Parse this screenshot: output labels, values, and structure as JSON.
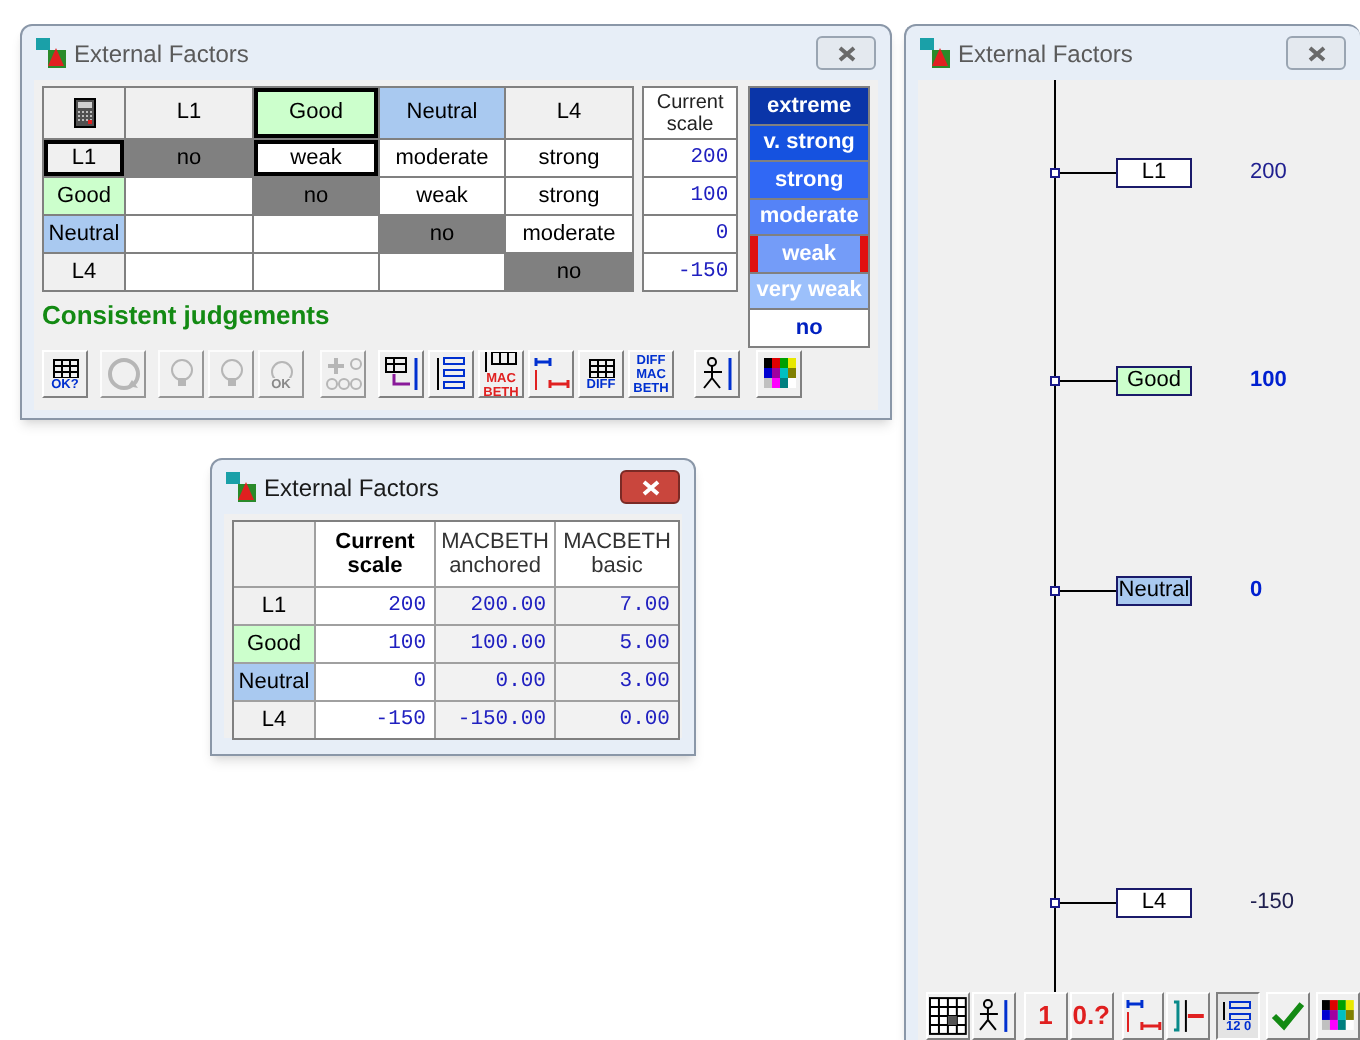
{
  "judgement_window": {
    "title": "External Factors",
    "active": false,
    "columns": [
      {
        "label": "L1",
        "color": "#f0f0f0",
        "selected": false
      },
      {
        "label": "Good",
        "color": "#ccffcc",
        "selected": true
      },
      {
        "label": "Neutral",
        "color": "#a9c9f0",
        "selected": false
      },
      {
        "label": "L4",
        "color": "#f0f0f0",
        "selected": false
      }
    ],
    "scale_header": "Current scale",
    "rows": [
      {
        "label": "L1",
        "color": "#f0f0f0",
        "selected": true,
        "scale": "200",
        "cells": [
          {
            "kind": "diagonal",
            "text": "no",
            "selected": false
          },
          {
            "kind": "judgement",
            "text": "weak",
            "selected": true
          },
          {
            "kind": "judgement",
            "text": "moderate",
            "selected": false
          },
          {
            "kind": "judgement",
            "text": "strong",
            "selected": false
          }
        ]
      },
      {
        "label": "Good",
        "color": "#ccffcc",
        "selected": false,
        "scale": "100",
        "cells": [
          {
            "kind": "empty",
            "selected": false
          },
          {
            "kind": "diagonal",
            "text": "no",
            "selected": false
          },
          {
            "kind": "judgement",
            "text": "weak",
            "selected": false
          },
          {
            "kind": "judgement",
            "text": "strong",
            "selected": false
          }
        ]
      },
      {
        "label": "Neutral",
        "color": "#a9c9f0",
        "selected": false,
        "scale": "0",
        "cells": [
          {
            "kind": "empty",
            "selected": false
          },
          {
            "kind": "empty",
            "selected": false
          },
          {
            "kind": "diagonal",
            "text": "no",
            "selected": false
          },
          {
            "kind": "judgement",
            "text": "moderate",
            "selected": false
          }
        ]
      },
      {
        "label": "L4",
        "color": "#f0f0f0",
        "selected": false,
        "scale": "-150",
        "cells": [
          {
            "kind": "empty",
            "selected": false
          },
          {
            "kind": "empty",
            "selected": false
          },
          {
            "kind": "empty",
            "selected": false
          },
          {
            "kind": "diagonal",
            "text": "no",
            "selected": false
          }
        ]
      }
    ],
    "categories": [
      {
        "label": "extreme",
        "color": "#0a35a8",
        "selected": false
      },
      {
        "label": "v. strong",
        "color": "#1552e0",
        "selected": false
      },
      {
        "label": "strong",
        "color": "#3068f5",
        "selected": false
      },
      {
        "label": "moderate",
        "color": "#5583f7",
        "selected": false
      },
      {
        "label": "weak",
        "color": "#749cf8",
        "selected": true
      },
      {
        "label": "very weak",
        "color": "#9cc0fb",
        "selected": false
      },
      {
        "label": "no",
        "color": "#ffffff",
        "selected": false
      }
    ],
    "status": "Consistent judgements",
    "toolbar": [
      {
        "kind": "grid",
        "text": "OK?",
        "disabled": false
      },
      {
        "kind": "refresh",
        "disabled": true
      },
      {
        "kind": "bulb",
        "disabled": true
      },
      {
        "kind": "bulb",
        "disabled": true
      },
      {
        "kind": "bulb",
        "text": "OK",
        "disabled": true
      },
      {
        "kind": "plus",
        "disabled": true
      },
      {
        "kind": "grid-arrow",
        "disabled": false
      },
      {
        "kind": "list",
        "disabled": false
      },
      {
        "kind": "columns",
        "text": "MAC BETH",
        "disabled": false
      },
      {
        "kind": "interval",
        "disabled": false
      },
      {
        "kind": "grid",
        "text": "DIFF",
        "disabled": false
      },
      {
        "kind": "label",
        "text": "DIFF MAC BETH",
        "disabled": false
      },
      {
        "kind": "figure",
        "disabled": false
      },
      {
        "kind": "palette",
        "disabled": false
      }
    ]
  },
  "scales_window": {
    "title": "External Factors",
    "active": true,
    "columns": [
      {
        "label": "Current scale",
        "bold": true
      },
      {
        "label": "MACBETH anchored",
        "bold": false
      },
      {
        "label": "MACBETH basic",
        "bold": false
      }
    ],
    "rows": [
      {
        "label": "L1",
        "color": "#f0f0f0",
        "values": [
          "200",
          "200.00",
          "7.00"
        ]
      },
      {
        "label": "Good",
        "color": "#ccffcc",
        "values": [
          "100",
          "100.00",
          "5.00"
        ]
      },
      {
        "label": "Neutral",
        "color": "#a9c9f0",
        "values": [
          "0",
          "0.00",
          "3.00"
        ]
      },
      {
        "label": "L4",
        "color": "#f0f0f0",
        "values": [
          "-150",
          "-150.00",
          "0.00"
        ]
      }
    ]
  },
  "thermometer_window": {
    "title": "External Factors",
    "active": false,
    "nodes": [
      {
        "label": "L1",
        "color": "#ffffff",
        "value": "200",
        "reference": false
      },
      {
        "label": "Good",
        "color": "#ccffcc",
        "value": "100",
        "reference": true
      },
      {
        "label": "Neutral",
        "color": "#a9c9f0",
        "value": "0",
        "reference": true
      },
      {
        "label": "L4",
        "color": "#ffffff",
        "value": "-150",
        "reference": false
      }
    ],
    "toolbar": [
      {
        "kind": "grid",
        "disabled": false,
        "selected": false
      },
      {
        "kind": "figure",
        "disabled": false,
        "selected": false
      },
      {
        "kind": "label",
        "text": "1",
        "disabled": false,
        "selected": false
      },
      {
        "kind": "label",
        "text": "0.?",
        "disabled": false,
        "selected": false
      },
      {
        "kind": "interval",
        "disabled": false,
        "selected": false
      },
      {
        "kind": "bracket",
        "disabled": false,
        "selected": false
      },
      {
        "kind": "list",
        "text": "12 0",
        "disabled": false,
        "selected": true
      },
      {
        "kind": "check",
        "disabled": false,
        "selected": false
      },
      {
        "kind": "palette",
        "disabled": false,
        "selected": false
      }
    ]
  }
}
